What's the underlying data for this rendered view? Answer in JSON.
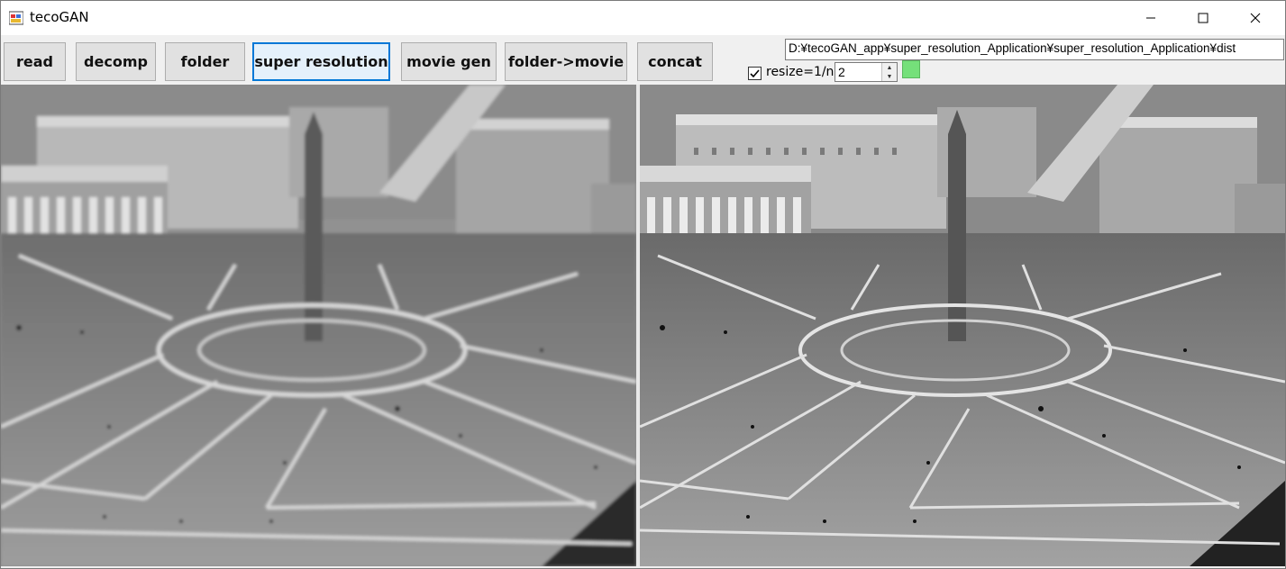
{
  "window": {
    "title": "tecoGAN",
    "controls": {
      "minimize": "minimize-icon",
      "maximize": "maximize-icon",
      "close": "close-icon"
    }
  },
  "toolbar": {
    "read_label": "read",
    "decomp_label": "decomp",
    "folder_label": "folder",
    "super_resolution_label": "super resolution",
    "movie_gen_label": "movie gen",
    "folder_to_movie_label": "folder->movie",
    "concat_label": "concat"
  },
  "path": {
    "value": "D:¥tecoGAN_app¥super_resolution_Application¥super_resolution_Application¥dist"
  },
  "resize": {
    "checked": true,
    "label": "resize=1/n",
    "n_value": "2"
  },
  "status": {
    "color": "#75e07a"
  },
  "images": {
    "left": {
      "description_icon": "input-frame-image"
    },
    "right": {
      "description_icon": "output-frame-image"
    }
  }
}
